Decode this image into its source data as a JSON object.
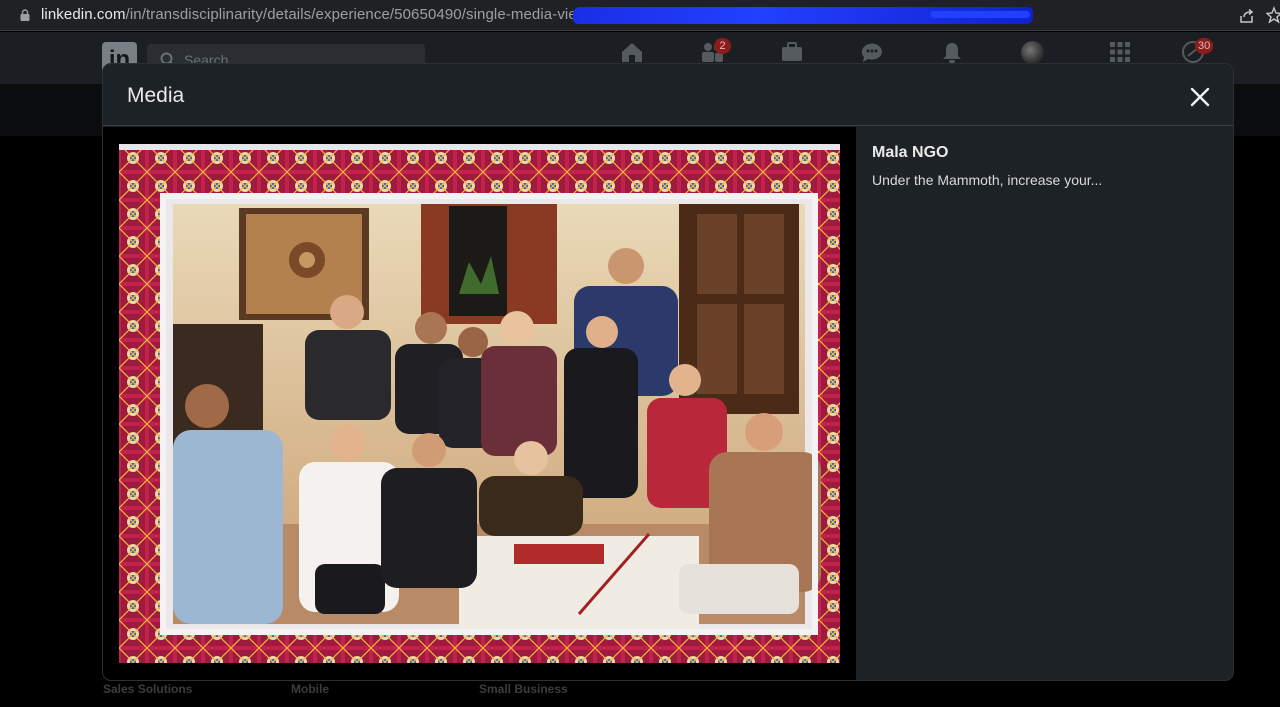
{
  "browser": {
    "url_host": "linkedin.com",
    "url_path": "/in/transdisciplinarity/details/experience/50650490/single-media-viewer/"
  },
  "navbar": {
    "logo_text": "in",
    "search_placeholder": "Search",
    "my_network_badge": "2",
    "notifications_badge": "30"
  },
  "modal": {
    "title": "Media",
    "media_title": "Mala NGO",
    "media_description": "Under the Mammoth, increase your..."
  },
  "footer": {
    "links": [
      "Sales Solutions",
      "Mobile",
      "Small Business"
    ]
  },
  "colors": {
    "modal_bg": "#1d2226",
    "overlay_bg": "#000000",
    "badge_red": "#8c1d1d",
    "redaction_blue": "#2240ff"
  },
  "icons": {
    "nav": [
      "home-icon",
      "my-network-icon",
      "jobs-icon",
      "messaging-icon",
      "notifications-icon",
      "me-avatar",
      "work-grid-icon",
      "premium-icon"
    ]
  }
}
